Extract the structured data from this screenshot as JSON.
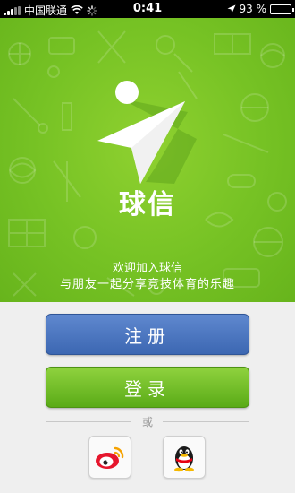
{
  "status_bar": {
    "carrier": "中国联通",
    "time": "0:41",
    "battery": "93 %",
    "battery_level": 0.93
  },
  "hero": {
    "app_name": "球信",
    "welcome_line1": "欢迎加入球信",
    "welcome_line2": "与朋友一起分享竞技体育的乐趣"
  },
  "actions": {
    "register_label": "注册",
    "login_label": "登录",
    "or_label": "或"
  },
  "social_logins": [
    {
      "icon": "weibo-icon"
    },
    {
      "icon": "qq-icon"
    }
  ],
  "colors": {
    "hero_green": "#76c224",
    "register_blue": "#4a74bd",
    "login_green": "#6dbb25"
  }
}
